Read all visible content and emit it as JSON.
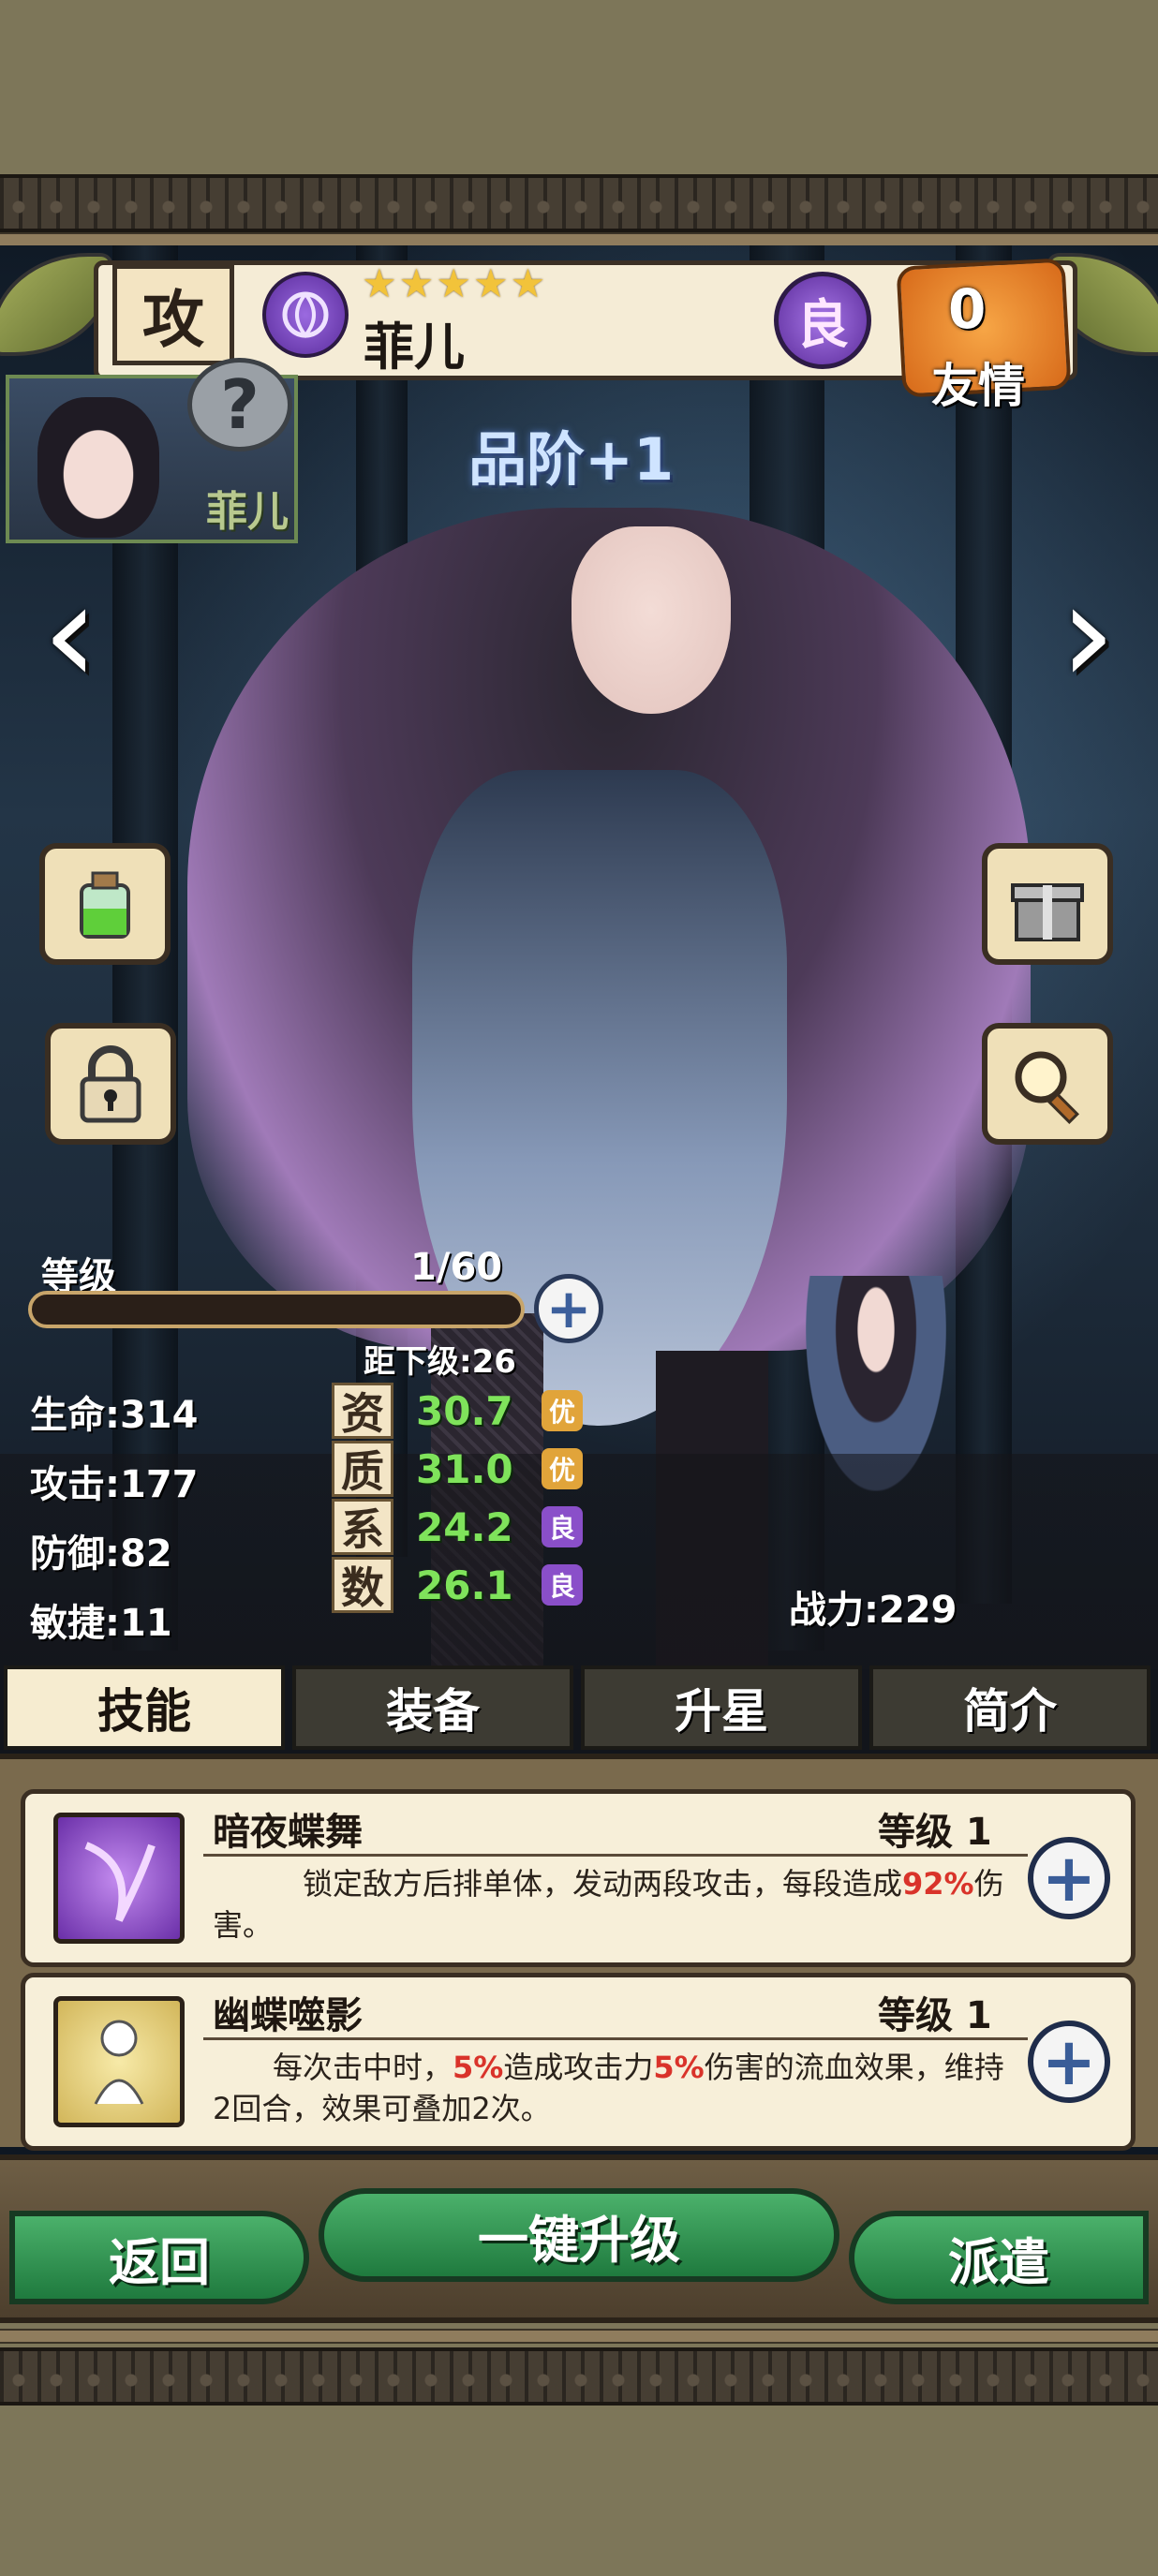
{
  "header": {
    "role_label": "攻",
    "element_icon": "swirl-element-icon",
    "stars": [
      "★",
      "★",
      "★",
      "★",
      "★"
    ],
    "name": "菲儿",
    "quality_badge": "良",
    "friendship_value": "0",
    "friendship_label": "友情"
  },
  "portrait": {
    "name": "菲儿",
    "unknown_mark": "?"
  },
  "grade_label": "品阶+1",
  "nav": {
    "prev": "‹",
    "next": "›"
  },
  "side_buttons": {
    "potion": "potion-icon",
    "lock": "lock-icon",
    "gift": "gift-icon",
    "search": "magnifier-icon"
  },
  "level": {
    "label": "等级",
    "value": "1/60",
    "progress": 0,
    "next_label": "距下级:26",
    "plus": "+"
  },
  "attributes": [
    {
      "label": "生命:314"
    },
    {
      "label": "攻击:177"
    },
    {
      "label": "防御:82"
    },
    {
      "label": "敏捷:11"
    }
  ],
  "growth": [
    {
      "char": "资",
      "value": "30.7",
      "rank": "优",
      "rank_color": "#e1a43a"
    },
    {
      "char": "质",
      "value": "31.0",
      "rank": "优",
      "rank_color": "#e1a43a"
    },
    {
      "char": "系",
      "value": "24.2",
      "rank": "良",
      "rank_color": "#8a4fc9"
    },
    {
      "char": "数",
      "value": "26.1",
      "rank": "良",
      "rank_color": "#8a4fc9"
    }
  ],
  "power": "战力:229",
  "tabs": [
    "技能",
    "装备",
    "升星",
    "简介"
  ],
  "skills": [
    {
      "name": "暗夜蝶舞",
      "level": "等级 1",
      "desc_parts": [
        "锁定敌方后排单体，发动两段攻击，每段造成",
        "92%",
        "伤害。"
      ]
    },
    {
      "name": "幽蝶噬影",
      "level": "等级 1",
      "desc_parts": [
        "每次击中时，",
        "5%",
        "造成攻击力",
        "5%",
        "伤害的流血效果，维持2回合，效果可叠加2次。"
      ]
    }
  ],
  "bottom": {
    "back": "返回",
    "upgrade_all": "一键升级",
    "dispatch": "派遣"
  },
  "colors": {
    "accent_green": "#2f9a55",
    "quality_purple": "#7a3fc0",
    "stat_green": "#7fe35b",
    "highlight_red": "#d9332a"
  }
}
